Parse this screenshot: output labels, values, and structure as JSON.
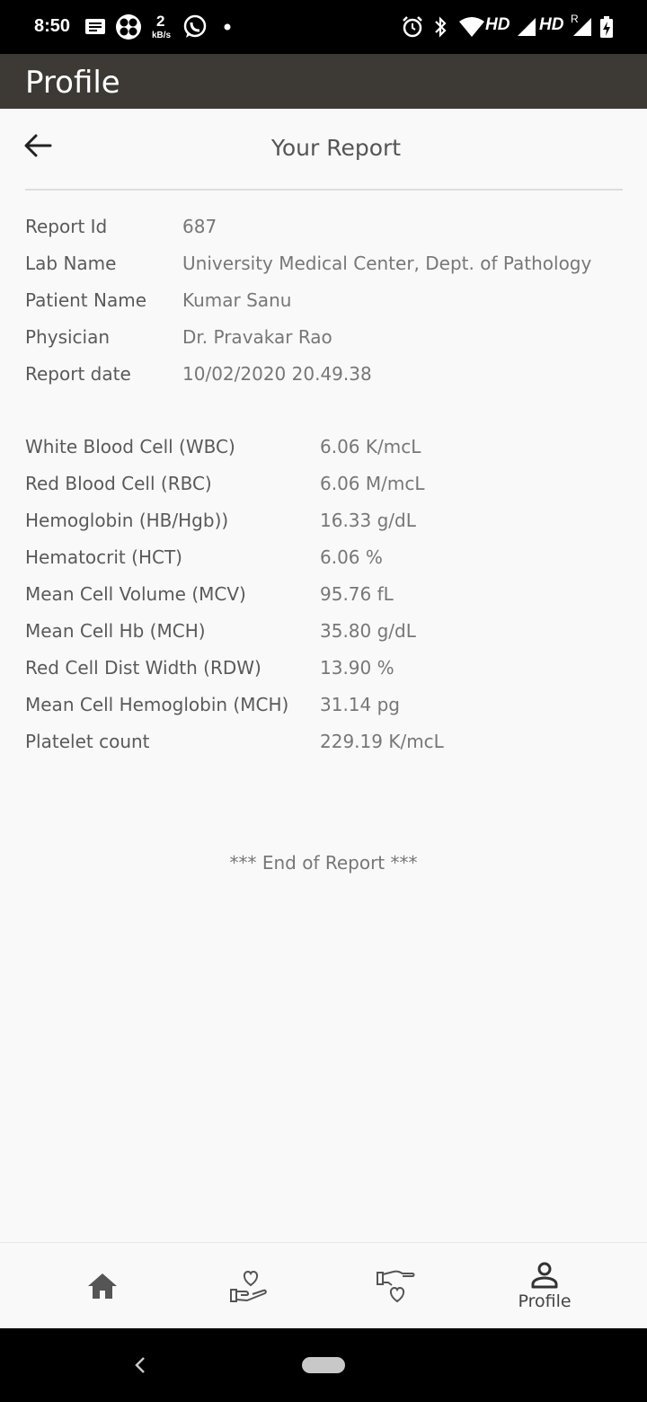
{
  "status_bar": {
    "time": "8:50",
    "net_speed_value": "2",
    "net_speed_unit": "kB/s",
    "hd1": "HD",
    "hd2": "HD",
    "roaming": "R",
    "icons": [
      "message-icon",
      "fan-icon",
      "whatsapp-icon",
      "dot-icon",
      "alarm-icon",
      "bluetooth-icon",
      "wifi-icon",
      "signal-icon",
      "battery-charging-icon"
    ]
  },
  "app_bar": {
    "title": "Profile"
  },
  "header": {
    "title": "Your Report"
  },
  "info": [
    {
      "label": "Report Id",
      "value": "687"
    },
    {
      "label": "Lab Name",
      "value": "University Medical Center, Dept. of Pathology"
    },
    {
      "label": "Patient Name",
      "value": "Kumar Sanu"
    },
    {
      "label": "Physician",
      "value": "Dr. Pravakar Rao"
    },
    {
      "label": "Report date",
      "value": "10/02/2020 20.49.38"
    }
  ],
  "results": [
    {
      "label": "White Blood Cell (WBC)",
      "value": "6.06 K/mcL"
    },
    {
      "label": "Red Blood Cell (RBC)",
      "value": "6.06 M/mcL"
    },
    {
      "label": "Hemoglobin (HB/Hgb))",
      "value": "16.33 g/dL"
    },
    {
      "label": "Hematocrit (HCT)",
      "value": "6.06 %"
    },
    {
      "label": "Mean Cell Volume (MCV)",
      "value": "95.76 fL"
    },
    {
      "label": "Mean Cell Hb (MCH)",
      "value": "35.80 g/dL"
    },
    {
      "label": "Red Cell Dist Width (RDW)",
      "value": "13.90 %"
    },
    {
      "label": "Mean Cell Hemoglobin (MCH)",
      "value": "31.14 pg"
    },
    {
      "label": "Platelet count",
      "value": "229.19 K/mcL"
    }
  ],
  "footer": {
    "end_text": "*** End of Report ***"
  },
  "bottom_nav": {
    "items": [
      {
        "icon": "home-icon",
        "label": ""
      },
      {
        "icon": "heart-hand-icon",
        "label": ""
      },
      {
        "icon": "hand-heart-icon",
        "label": ""
      },
      {
        "icon": "person-icon",
        "label": "Profile"
      }
    ]
  },
  "colors": {
    "app_bar": "#3d3a36",
    "background": "#f9f9f9",
    "text": "#555555"
  }
}
